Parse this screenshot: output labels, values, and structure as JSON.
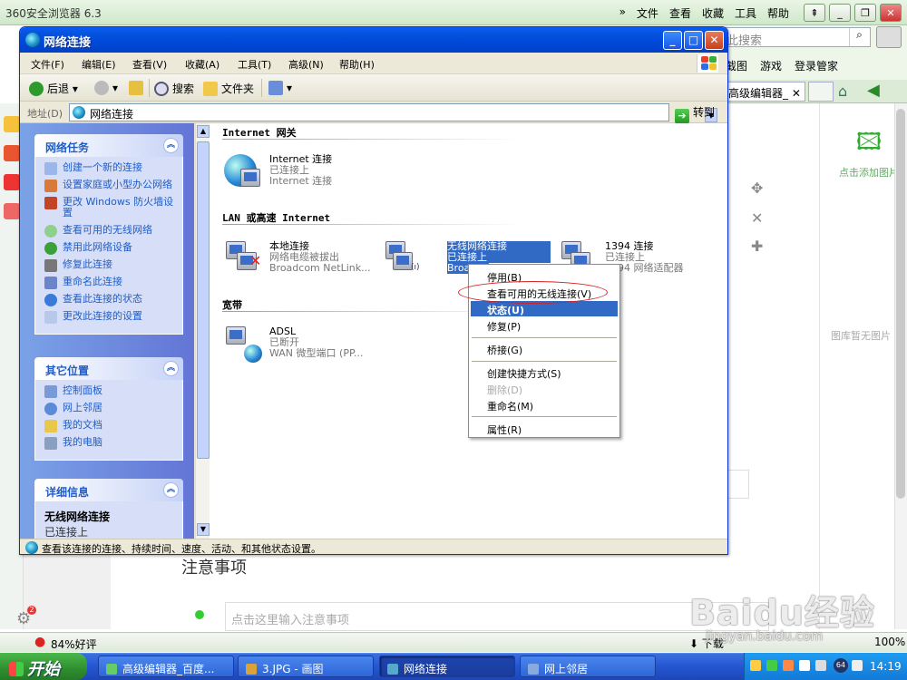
{
  "browser": {
    "title": "360安全浏览器 6.3",
    "menu": [
      "»",
      "文件",
      "查看",
      "收藏",
      "工具",
      "帮助"
    ],
    "search_placeholder": "此搜索",
    "links": [
      "截图",
      "游戏",
      "登录管家"
    ],
    "active_tab": "高级编辑器_",
    "add_image": "点击添加图片",
    "no_image": "图库暂无图片",
    "notes_title": "注意事项",
    "notes_placeholder": "点击这里输入注意事项",
    "rating": "84%好评",
    "download": "下载",
    "zoom": "100%",
    "gear_badge": "2"
  },
  "watermark": {
    "big": "Baidu经验",
    "small": "jingyan.baidu.com"
  },
  "taskbar": {
    "start": "开始",
    "tasks": [
      "高级编辑器_百度...",
      "3.JPG - 画图",
      "网络连接",
      "网上邻居"
    ],
    "tray_badge": "64",
    "time": "14:19"
  },
  "window": {
    "title": "网络连接",
    "menu": [
      "文件(F)",
      "编辑(E)",
      "查看(V)",
      "收藏(A)",
      "工具(T)",
      "高级(N)",
      "帮助(H)"
    ],
    "toolbar": {
      "back": "后退",
      "search": "搜索",
      "folders": "文件夹"
    },
    "address_label": "地址(D)",
    "address_value": "网络连接",
    "goto": "转到",
    "status_text": "查看该连接的连接、持续时间、速度、活动、和其他状态设置。"
  },
  "taskpane": {
    "network_tasks": {
      "title": "网络任务",
      "items": [
        "创建一个新的连接",
        "设置家庭或小型办公网络",
        "更改 Windows 防火墙设置",
        "查看可用的无线网络",
        "禁用此网络设备",
        "修复此连接",
        "重命名此连接",
        "查看此连接的状态",
        "更改此连接的设置"
      ]
    },
    "other_places": {
      "title": "其它位置",
      "items": [
        "控制面板",
        "网上邻居",
        "我的文档",
        "我的电脑"
      ]
    },
    "details": {
      "title": "详细信息",
      "name": "无线网络连接",
      "state": "已连接上"
    }
  },
  "content": {
    "groups": [
      "Internet 网关",
      "LAN 或高速 Internet",
      "宽带"
    ],
    "connections": [
      {
        "name": "Internet 连接",
        "status": "已连接上",
        "device": "Internet 连接"
      },
      {
        "name": "本地连接",
        "status": "网络电缆被拔出",
        "device": "Broadcom NetLink..."
      },
      {
        "name": "无线网络连接",
        "status": "已连接上",
        "device": "Broadcom"
      },
      {
        "name": "1394 连接",
        "status": "已连接上",
        "device": "1394 网络适配器"
      },
      {
        "name": "ADSL",
        "status": "已断开",
        "device": "WAN 微型端口 (PP..."
      }
    ]
  },
  "context_menu": {
    "items": [
      "停用(B)",
      "查看可用的无线连接(V)",
      "状态(U)",
      "修复(P)",
      "桥接(G)",
      "创建快捷方式(S)",
      "删除(D)",
      "重命名(M)",
      "属性(R)"
    ]
  },
  "colors": {
    "xp_blue": "#0054e3",
    "highlight": "#316ac5",
    "oval": "#d62020",
    "task_link": "#215dc6"
  }
}
